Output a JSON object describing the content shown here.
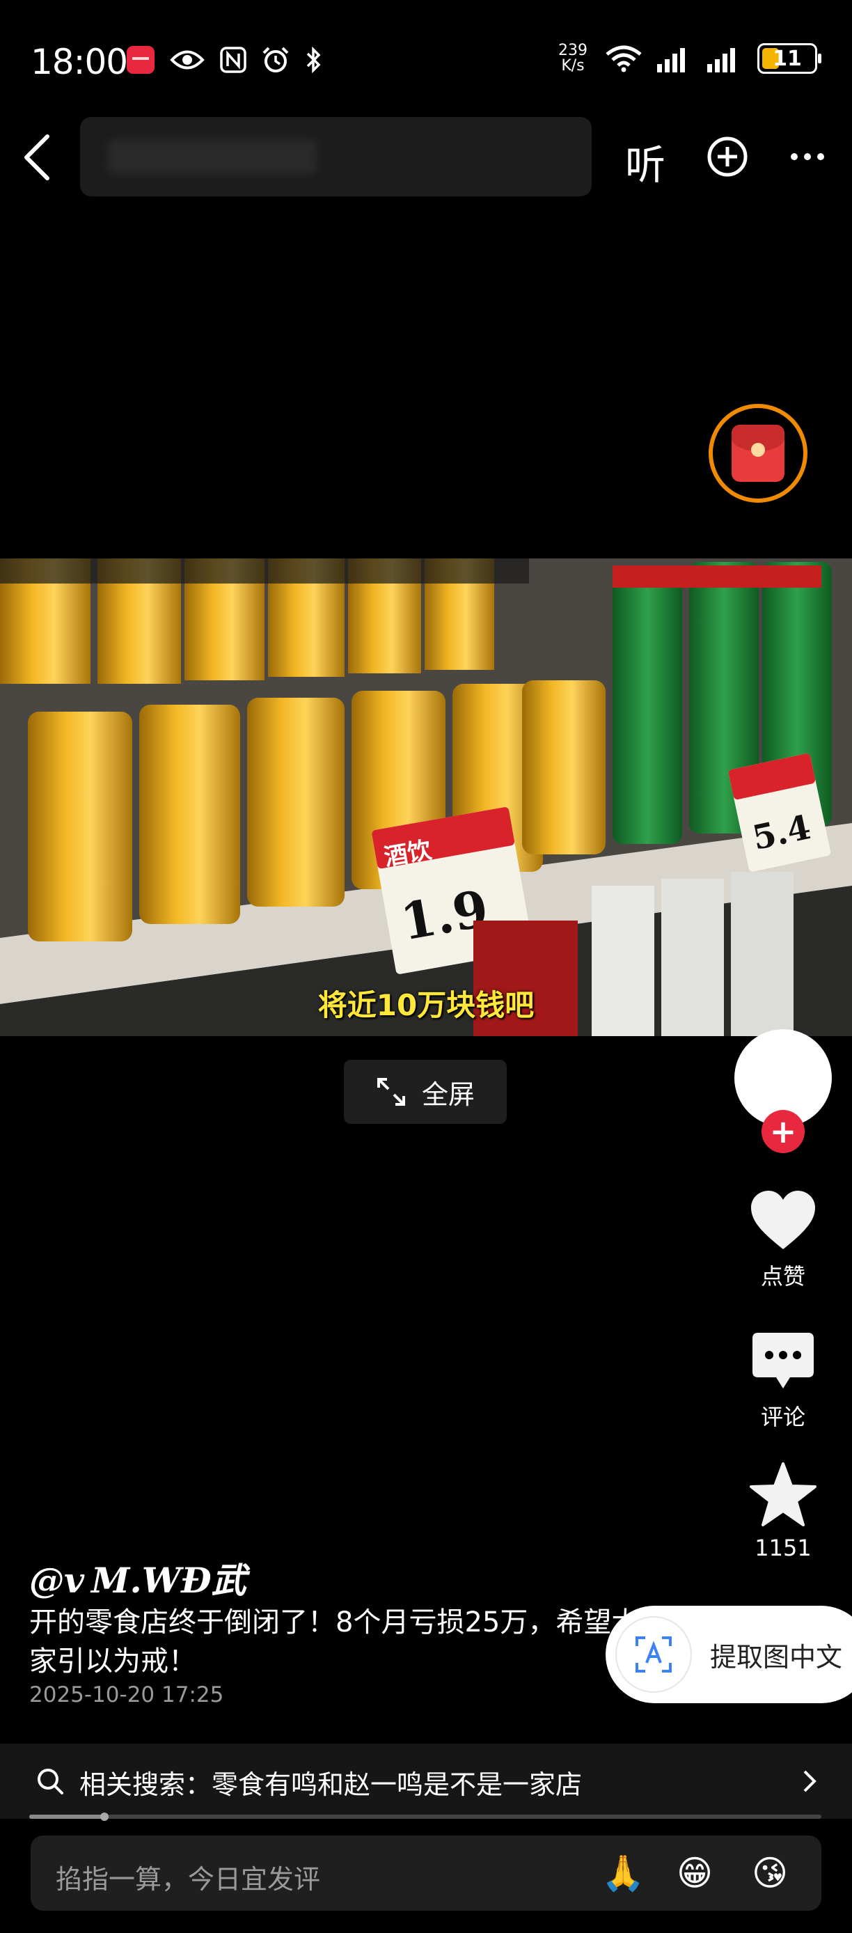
{
  "status_bar": {
    "time": "18:00",
    "net_speed_value": "239",
    "net_speed_unit": "K/s",
    "battery": "11",
    "battery_level_fraction": 0.11,
    "left_icons": [
      "huawei-app-icon",
      "eye-icon",
      "nfc-icon",
      "alarm-icon",
      "bluetooth-icon"
    ],
    "right_icons": [
      "wifi-icon",
      "signal-icon",
      "signal-icon",
      "battery-icon"
    ]
  },
  "nav": {
    "listen_label": "听",
    "icons": [
      "back-icon",
      "add-circle-icon",
      "more-icon"
    ]
  },
  "video": {
    "subtitle": "将近10万块钱吧",
    "price_tag_label": "酒饮",
    "price_big": "1.9",
    "price_side": "5.4"
  },
  "fullscreen": {
    "label": "全屏"
  },
  "rail": {
    "like_label": "点赞",
    "comment_label": "评论",
    "favorite_count": "1151"
  },
  "post": {
    "author": "@v M.WĐ武",
    "description": "开的零食店终于倒闭了！8个月亏损25万，希望大家引以为戒！",
    "date": "2025-10-20 17:25"
  },
  "extract_text": {
    "label": "提取图中文"
  },
  "related": {
    "text": "相关搜索：零食有鸣和赵一鸣是不是一家店",
    "progress_fraction": 0.095
  },
  "comment_bar": {
    "placeholder": "掐指一算，今日宜发评",
    "emojis": [
      "🙏",
      "😁",
      "😘"
    ]
  },
  "colors": {
    "background": "#000000",
    "follow_red": "#e8283f",
    "subtitle_yellow": "#ffe83a",
    "redpacket_ring": "#f08a00"
  }
}
